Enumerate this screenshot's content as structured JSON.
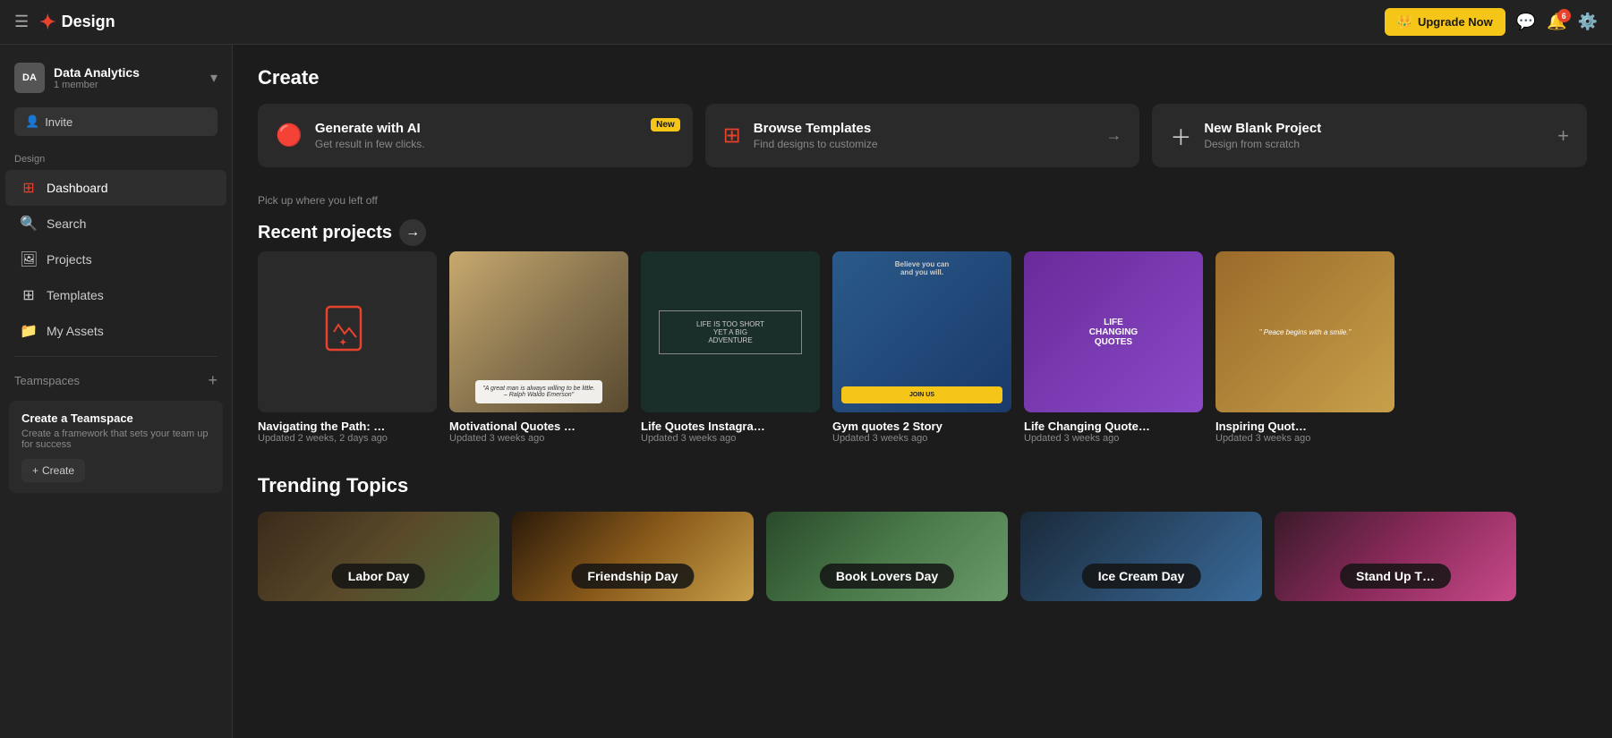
{
  "topnav": {
    "brand": "Design",
    "upgrade_label": "Upgrade Now",
    "notification_badge": "6"
  },
  "sidebar": {
    "workspace": {
      "initials": "DA",
      "name": "Data Analytics",
      "members": "1 member"
    },
    "invite_label": "Invite",
    "section_label": "Design",
    "items": [
      {
        "id": "dashboard",
        "label": "Dashboard",
        "icon": "⊞",
        "active": true
      },
      {
        "id": "search",
        "label": "Search",
        "icon": "🔍",
        "active": false
      },
      {
        "id": "projects",
        "label": "Projects",
        "icon": "🖼",
        "active": false
      },
      {
        "id": "templates",
        "label": "Templates",
        "icon": "⊞",
        "active": false
      },
      {
        "id": "my-assets",
        "label": "My Assets",
        "icon": "📁",
        "active": false
      }
    ],
    "teamspaces_label": "Teamspaces",
    "create_teamspace": {
      "title": "Create a Teamspace",
      "description": "Create a framework that sets your team up for success",
      "button_label": "Create"
    }
  },
  "main": {
    "create_section": {
      "title": "Create",
      "cards": [
        {
          "id": "ai",
          "title": "Generate with AI",
          "subtitle": "Get result in few clicks.",
          "badge": "New",
          "has_badge": true,
          "has_arrow": true,
          "has_plus": false
        },
        {
          "id": "browse",
          "title": "Browse Templates",
          "subtitle": "Find designs to customize",
          "has_badge": false,
          "has_arrow": true,
          "has_plus": false
        },
        {
          "id": "new",
          "title": "New Blank Project",
          "subtitle": "Design from scratch",
          "has_badge": false,
          "has_arrow": false,
          "has_plus": true
        }
      ]
    },
    "recent_projects": {
      "pickup_text": "Pick up where you left off",
      "title": "Recent projects",
      "items": [
        {
          "id": "p1",
          "name": "Navigating the Path: …",
          "updated": "Updated 2 weeks, 2 days ago",
          "thumb_type": "placeholder"
        },
        {
          "id": "p2",
          "name": "Motivational Quotes …",
          "updated": "Updated 3 weeks ago",
          "thumb_type": "suit"
        },
        {
          "id": "p3",
          "name": "Life Quotes Instagra…",
          "updated": "Updated 3 weeks ago",
          "thumb_type": "dark-quote"
        },
        {
          "id": "p4",
          "name": "Gym quotes 2 Story",
          "updated": "Updated 3 weeks ago",
          "thumb_type": "gym"
        },
        {
          "id": "p5",
          "name": "Life Changing Quote…",
          "updated": "Updated 3 weeks ago",
          "thumb_type": "life-quotes"
        },
        {
          "id": "p6",
          "name": "Inspiring Quot…",
          "updated": "Updated 3 weeks ago",
          "thumb_type": "peace"
        }
      ]
    },
    "trending": {
      "title": "Trending Topics",
      "items": [
        {
          "id": "labor",
          "label": "Labor Day",
          "bg_class": "tc-labor"
        },
        {
          "id": "friendship",
          "label": "Friendship Day",
          "bg_class": "tc-friendship"
        },
        {
          "id": "booklovers",
          "label": "Book Lovers Day",
          "bg_class": "tc-booklovers"
        },
        {
          "id": "icecream",
          "label": "Ice Cream Day",
          "bg_class": "tc-icecream"
        },
        {
          "id": "standup",
          "label": "Stand Up T…",
          "bg_class": "tc-standup"
        }
      ]
    }
  }
}
